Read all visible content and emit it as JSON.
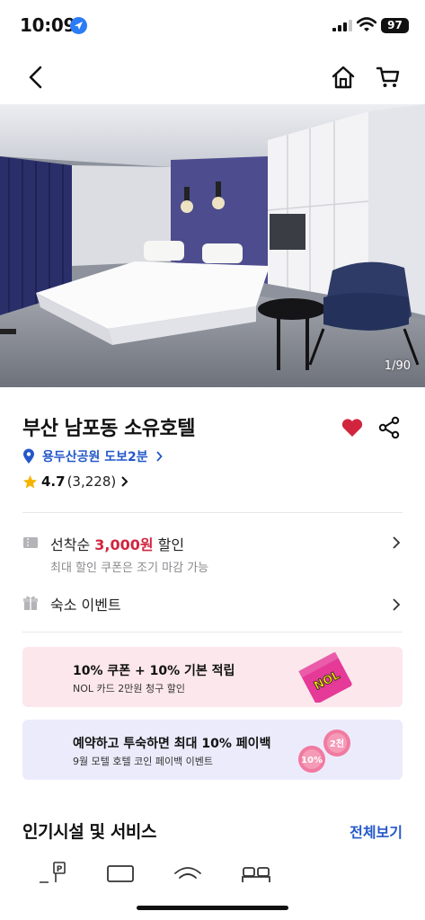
{
  "status_bar": {
    "time": "10:09",
    "battery": "97",
    "icons": [
      "location-arrow-icon",
      "signal-icon",
      "wifi-icon",
      "battery-icon"
    ]
  },
  "nav": {
    "icons": [
      "back-icon",
      "home-icon",
      "cart-icon"
    ]
  },
  "gallery": {
    "counter": "1/90"
  },
  "hotel": {
    "name": "부산 남포동 소유호텔",
    "location": "용두산공원 도보2분",
    "rating": "4.7",
    "review_count": "(3,228)",
    "favorite_color": "#d1253f"
  },
  "coupon_row": {
    "title_prefix": "선착순 ",
    "amount": "3,000원",
    "title_suffix": " 할인",
    "subtitle": "최대 할인 쿠폰은 조기 마감 가능"
  },
  "event_row": {
    "title": "숙소 이벤트"
  },
  "banners": [
    {
      "title": "10% 쿠폰 + 10% 기본 적립",
      "subtitle": "NOL 카드 2만원 청구 할인",
      "card_logo": "NOL",
      "background": "#fbe7ec"
    },
    {
      "title": "예약하고 투숙하면 최대 10% 페이백",
      "subtitle": "9월 모텔 호텔 코인 페이백 이벤트",
      "coin_labels": [
        "10%",
        "2천"
      ],
      "background": "#ecebfb"
    }
  ],
  "amenities_section": {
    "title": "인기시설 및 서비스",
    "view_all": "전체보기",
    "icons": [
      "parking-icon",
      "tv-icon",
      "wifi-icon",
      "bed-icon"
    ]
  },
  "colors": {
    "accent_blue": "#2458c9",
    "accent_red": "#d1253f",
    "star": "#f6b400"
  }
}
